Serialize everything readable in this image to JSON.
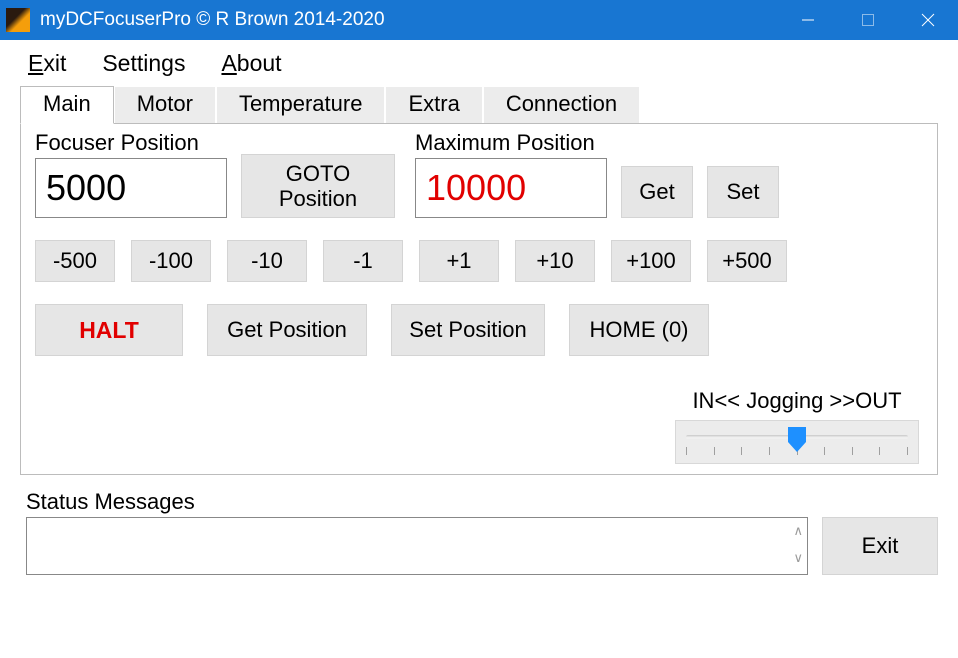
{
  "window": {
    "title": "myDCFocuserPro © R Brown 2014-2020"
  },
  "menu": {
    "exit": "Exit",
    "settings": "Settings",
    "about": "About"
  },
  "tabs": {
    "main": "Main",
    "motor": "Motor",
    "temperature": "Temperature",
    "extra": "Extra",
    "connection": "Connection"
  },
  "focuser": {
    "label": "Focuser Position",
    "value": "5000",
    "goto": "GOTO\nPosition"
  },
  "maxpos": {
    "label": "Maximum Position",
    "value": "10000",
    "get": "Get",
    "set": "Set"
  },
  "steps": {
    "m500": "-500",
    "m100": "-100",
    "m10": "-10",
    "m1": "-1",
    "p1": "+1",
    "p10": "+10",
    "p100": "+100",
    "p500": "+500"
  },
  "actions": {
    "halt": "HALT",
    "getpos": "Get Position",
    "setpos": "Set Position",
    "home": "HOME (0)"
  },
  "jog": {
    "label": "IN<< Jogging >>OUT"
  },
  "status": {
    "label": "Status Messages",
    "value": ""
  },
  "footer": {
    "exit": "Exit"
  },
  "colors": {
    "accent": "#1876d2",
    "danger": "#e10000"
  }
}
